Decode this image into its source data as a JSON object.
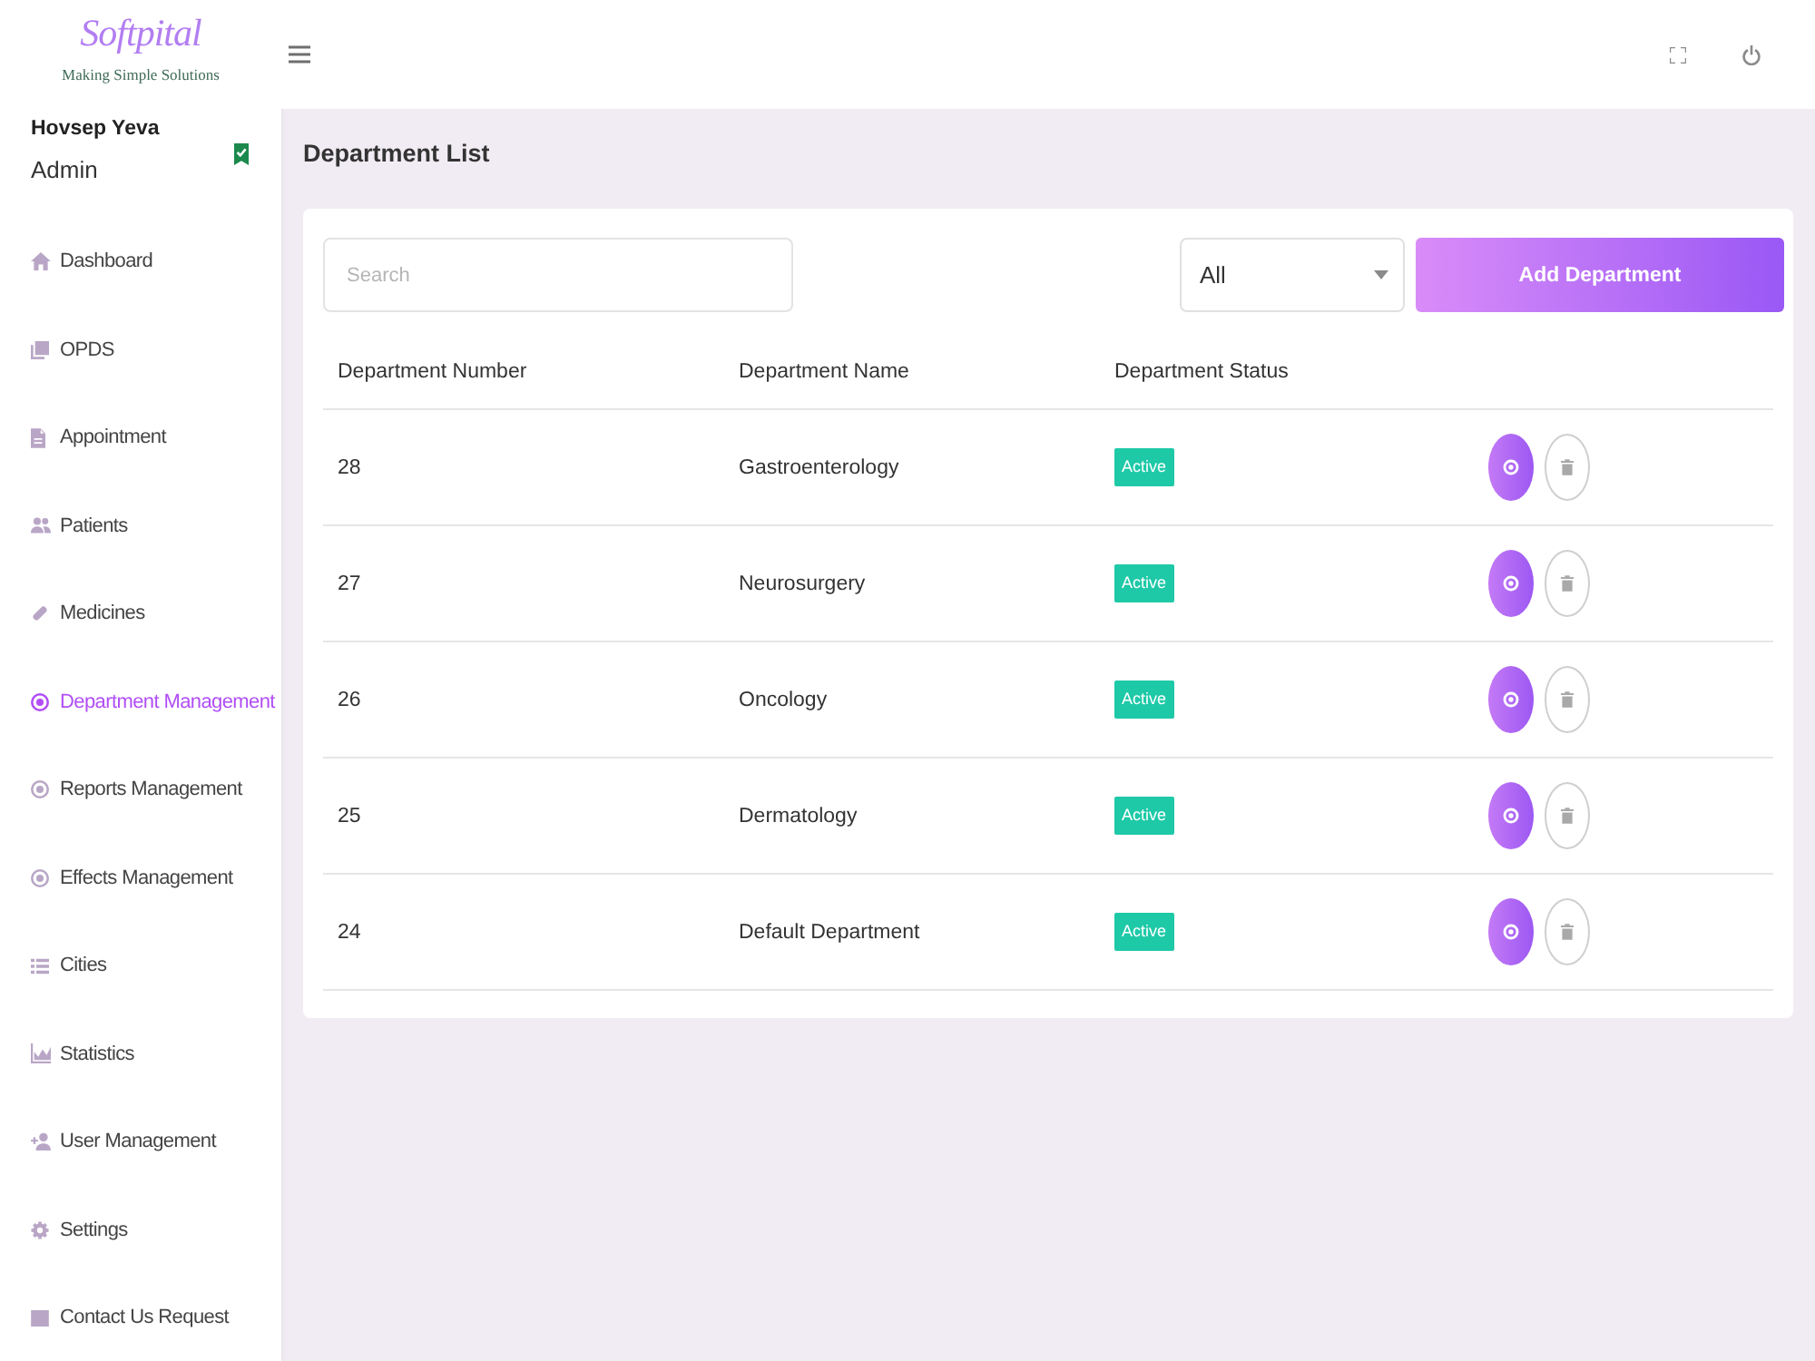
{
  "brand": {
    "name": "Softpital",
    "tagline": "Making Simple Solutions"
  },
  "user": {
    "name": "Hovsep Yeva",
    "role": "Admin"
  },
  "sidebar": {
    "items": [
      {
        "label": "Dashboard",
        "selected": false
      },
      {
        "label": "OPDS",
        "selected": false
      },
      {
        "label": "Appointment",
        "selected": false
      },
      {
        "label": "Patients",
        "selected": false
      },
      {
        "label": "Medicines",
        "selected": false
      },
      {
        "label": "Department Management",
        "selected": true
      },
      {
        "label": "Reports Management",
        "selected": false
      },
      {
        "label": "Effects Management",
        "selected": false
      },
      {
        "label": "Cities",
        "selected": false
      },
      {
        "label": "Statistics",
        "selected": false
      },
      {
        "label": "User Management",
        "selected": false
      },
      {
        "label": "Settings",
        "selected": false
      },
      {
        "label": "Contact Us Request",
        "selected": false
      }
    ]
  },
  "page": {
    "title": "Department List"
  },
  "toolbar": {
    "search": {
      "placeholder": "Search"
    },
    "filter": {
      "value": "All"
    },
    "add_button": "Add Department"
  },
  "table": {
    "columns": [
      "Department Number",
      "Department Name",
      "Department Status"
    ],
    "rows": [
      {
        "number": "28",
        "name": "Gastroenterology",
        "status": "Active"
      },
      {
        "number": "27",
        "name": "Neurosurgery",
        "status": "Active"
      },
      {
        "number": "26",
        "name": "Oncology",
        "status": "Active"
      },
      {
        "number": "25",
        "name": "Dermatology",
        "status": "Active"
      },
      {
        "number": "24",
        "name": "Default Department",
        "status": "Active"
      }
    ]
  }
}
